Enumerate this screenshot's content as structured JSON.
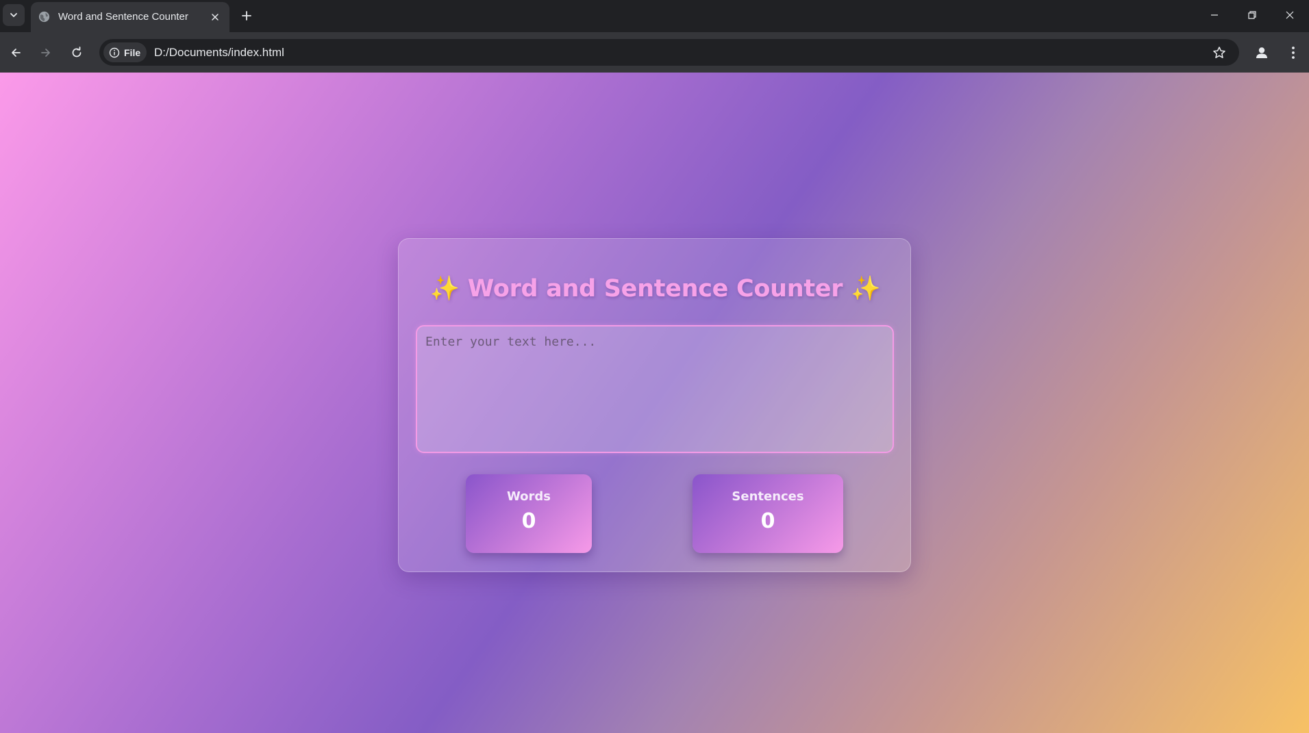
{
  "browser": {
    "tab_title": "Word and Sentence Counter",
    "chip_label": "File",
    "url": "D:/Documents/index.html"
  },
  "app": {
    "title_text": "Word and Sentence Counter",
    "title_emoji": "✨",
    "textarea_placeholder": "Enter your text here...",
    "stats": {
      "words_label": "Words",
      "words_value": "0",
      "sentences_label": "Sentences",
      "sentences_value": "0"
    }
  },
  "colors": {
    "title": "#f7a2e8",
    "textarea_border": "#f49be6",
    "sparkle": "#f9c23c"
  }
}
